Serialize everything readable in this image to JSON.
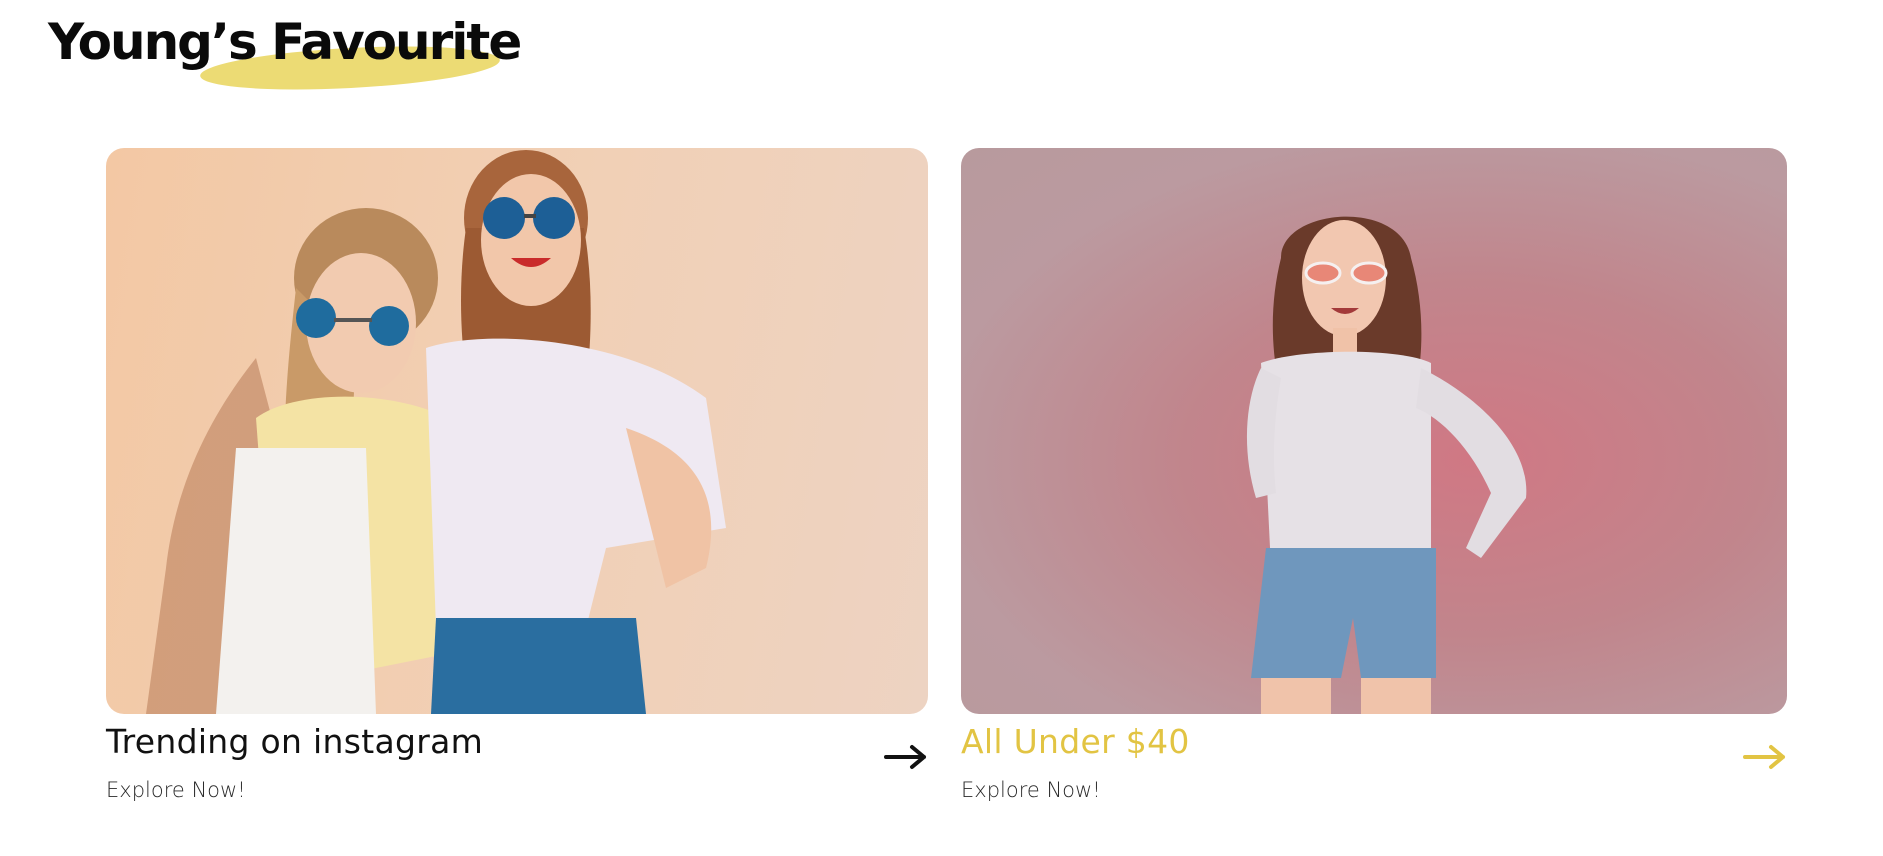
{
  "section": {
    "title": "Young’s Favourite",
    "highlight_color": "#ecdb74"
  },
  "cards": [
    {
      "title": "Trending on instagram",
      "link_text": "Explore Now!",
      "image_alt": "Two smiling young women wearing round blue sunglasses",
      "arrow_icon": "arrow-right-icon",
      "title_color": "#111111",
      "arrow_color": "#111111"
    },
    {
      "title": "All Under $40",
      "link_text": "Explore Now!",
      "image_alt": "Smiling young woman in white top and denim shorts",
      "arrow_icon": "arrow-right-icon",
      "title_color": "#e2c443",
      "arrow_color": "#e2c443"
    }
  ]
}
